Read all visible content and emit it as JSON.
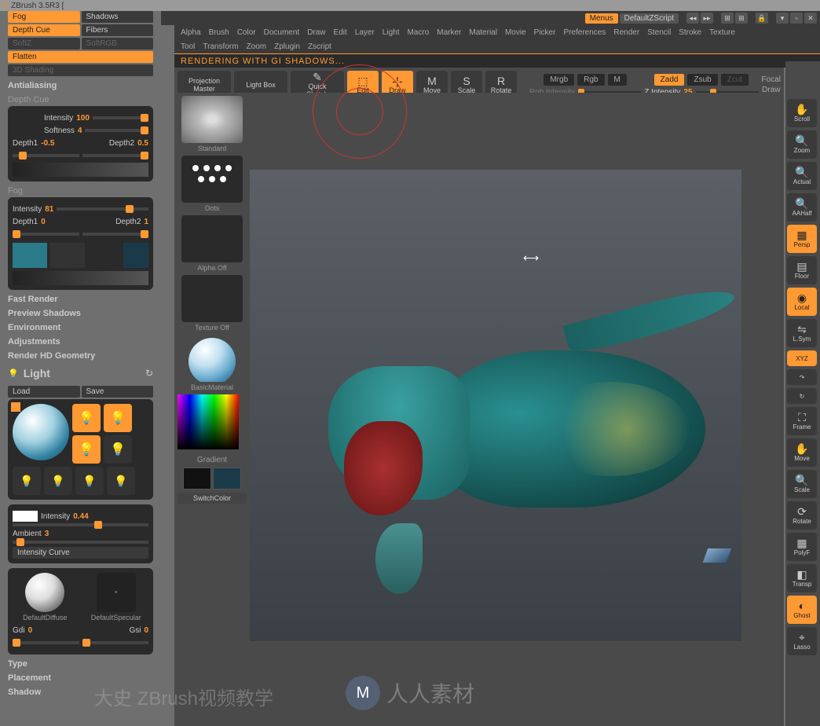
{
  "app": {
    "title": "ZBrush 3.5R3 ["
  },
  "top": {
    "menus_btn": "Menus",
    "script_btn": "DefaultZScript"
  },
  "menubar": [
    "Alpha",
    "Brush",
    "Color",
    "Document",
    "Draw",
    "Edit",
    "Layer",
    "Light",
    "Macro",
    "Marker",
    "Material",
    "Movie",
    "Picker",
    "Preferences",
    "Render",
    "Stencil",
    "Stroke",
    "Texture"
  ],
  "submenubar": [
    "Tool",
    "Transform",
    "Zoom",
    "Zplugin",
    "Zscript"
  ],
  "status": "RENDERING WITH GI SHADOWS...",
  "toolbar": {
    "projection": "Projection\nMaster",
    "lightbox": "Light Box",
    "quick": "Quick\nSketch",
    "edit": "Edit",
    "draw": "Draw",
    "move": "Move",
    "scale": "Scale",
    "rotate": "Rotate",
    "mrgb": "Mrgb",
    "rgb": "Rgb",
    "m": "M",
    "zadd": "Zadd",
    "zsub": "Zsub",
    "zcut": "Zcut",
    "focal": "Focal",
    "drawlbl": "Draw",
    "rgb_intensity": "Rgb Intensity",
    "z_intensity_label": "Z Intensity",
    "z_intensity_val": "25"
  },
  "left": {
    "fog": "Fog",
    "shadows": "Shadows",
    "depthcue": "Depth Cue",
    "fibers": "Fibers",
    "softz": "SoftZ",
    "softrgb": "SoftRGB",
    "flatten": "Flatten",
    "shading3d": "3D Shading",
    "antialiasing": "Antialiasing",
    "depthcue_hdr": "Depth Cue",
    "dc_intensity_lbl": "Intensity",
    "dc_intensity_val": "100",
    "dc_softness_lbl": "Softness",
    "dc_softness_val": "4",
    "dc_d1_lbl": "Depth1",
    "dc_d1_val": "-0.5",
    "dc_d2_lbl": "Depth2",
    "dc_d2_val": "0.5",
    "fog_hdr": "Fog",
    "fog_intensity_lbl": "Intensity",
    "fog_intensity_val": "81",
    "fog_d1_lbl": "Depth1",
    "fog_d1_val": "0",
    "fog_d2_lbl": "Depth2",
    "fog_d2_val": "1",
    "fast_render": "Fast Render",
    "preview_shadows": "Preview Shadows",
    "environment": "Environment",
    "adjustments": "Adjustments",
    "render_hd": "Render HD Geometry",
    "light_hdr": "Light",
    "load": "Load",
    "save": "Save",
    "li_intensity_lbl": "Intensity",
    "li_intensity_val": "0.44",
    "li_ambient_lbl": "Ambient",
    "li_ambient_val": "3",
    "li_curve": "Intensity Curve",
    "diffuse": "DefaultDiffuse",
    "specular": "DefaultSpecular",
    "gdi_lbl": "Gdi",
    "gdi_val": "0",
    "gsi_lbl": "Gsi",
    "gsi_val": "0",
    "type": "Type",
    "placement": "Placement",
    "shadow": "Shadow"
  },
  "mid": {
    "standard": "Standard",
    "dots": "Dots",
    "alpha_off": "Alpha Off",
    "texture_off": "Texture Off",
    "basic_material": "BasicMaterial",
    "gradient": "Gradient",
    "switchcolor": "SwitchColor"
  },
  "right": {
    "scroll": "Scroll",
    "zoom": "Zoom",
    "actual": "Actual",
    "aahalf": "AAHalf",
    "persp": "Persp",
    "floor": "Floor",
    "local": "Local",
    "lsym": "L.Sym",
    "xyz": "XYZ",
    "frame": "Frame",
    "move": "Move",
    "scale": "Scale",
    "rotate": "Rotate",
    "polyf": "PolyF",
    "transp": "Transp",
    "ghost": "Ghost",
    "lasso": "Lasso"
  },
  "watermark1": "大史  ZBrush视频教学",
  "watermark2": "人人素材"
}
